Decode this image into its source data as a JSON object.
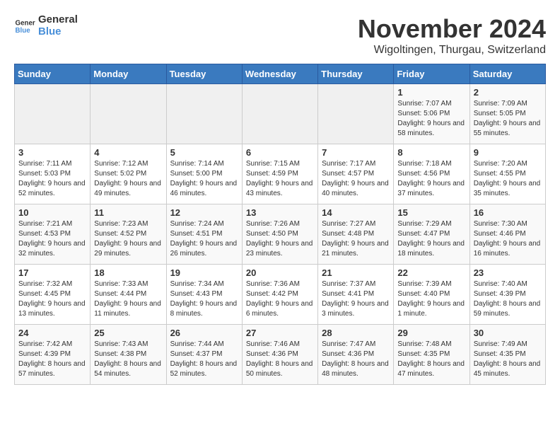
{
  "header": {
    "logo_general": "General",
    "logo_blue": "Blue",
    "month_title": "November 2024",
    "location": "Wigoltingen, Thurgau, Switzerland"
  },
  "weekdays": [
    "Sunday",
    "Monday",
    "Tuesday",
    "Wednesday",
    "Thursday",
    "Friday",
    "Saturday"
  ],
  "weeks": [
    [
      {
        "day": "",
        "info": ""
      },
      {
        "day": "",
        "info": ""
      },
      {
        "day": "",
        "info": ""
      },
      {
        "day": "",
        "info": ""
      },
      {
        "day": "",
        "info": ""
      },
      {
        "day": "1",
        "info": "Sunrise: 7:07 AM\nSunset: 5:06 PM\nDaylight: 9 hours and 58 minutes."
      },
      {
        "day": "2",
        "info": "Sunrise: 7:09 AM\nSunset: 5:05 PM\nDaylight: 9 hours and 55 minutes."
      }
    ],
    [
      {
        "day": "3",
        "info": "Sunrise: 7:11 AM\nSunset: 5:03 PM\nDaylight: 9 hours and 52 minutes."
      },
      {
        "day": "4",
        "info": "Sunrise: 7:12 AM\nSunset: 5:02 PM\nDaylight: 9 hours and 49 minutes."
      },
      {
        "day": "5",
        "info": "Sunrise: 7:14 AM\nSunset: 5:00 PM\nDaylight: 9 hours and 46 minutes."
      },
      {
        "day": "6",
        "info": "Sunrise: 7:15 AM\nSunset: 4:59 PM\nDaylight: 9 hours and 43 minutes."
      },
      {
        "day": "7",
        "info": "Sunrise: 7:17 AM\nSunset: 4:57 PM\nDaylight: 9 hours and 40 minutes."
      },
      {
        "day": "8",
        "info": "Sunrise: 7:18 AM\nSunset: 4:56 PM\nDaylight: 9 hours and 37 minutes."
      },
      {
        "day": "9",
        "info": "Sunrise: 7:20 AM\nSunset: 4:55 PM\nDaylight: 9 hours and 35 minutes."
      }
    ],
    [
      {
        "day": "10",
        "info": "Sunrise: 7:21 AM\nSunset: 4:53 PM\nDaylight: 9 hours and 32 minutes."
      },
      {
        "day": "11",
        "info": "Sunrise: 7:23 AM\nSunset: 4:52 PM\nDaylight: 9 hours and 29 minutes."
      },
      {
        "day": "12",
        "info": "Sunrise: 7:24 AM\nSunset: 4:51 PM\nDaylight: 9 hours and 26 minutes."
      },
      {
        "day": "13",
        "info": "Sunrise: 7:26 AM\nSunset: 4:50 PM\nDaylight: 9 hours and 23 minutes."
      },
      {
        "day": "14",
        "info": "Sunrise: 7:27 AM\nSunset: 4:48 PM\nDaylight: 9 hours and 21 minutes."
      },
      {
        "day": "15",
        "info": "Sunrise: 7:29 AM\nSunset: 4:47 PM\nDaylight: 9 hours and 18 minutes."
      },
      {
        "day": "16",
        "info": "Sunrise: 7:30 AM\nSunset: 4:46 PM\nDaylight: 9 hours and 16 minutes."
      }
    ],
    [
      {
        "day": "17",
        "info": "Sunrise: 7:32 AM\nSunset: 4:45 PM\nDaylight: 9 hours and 13 minutes."
      },
      {
        "day": "18",
        "info": "Sunrise: 7:33 AM\nSunset: 4:44 PM\nDaylight: 9 hours and 11 minutes."
      },
      {
        "day": "19",
        "info": "Sunrise: 7:34 AM\nSunset: 4:43 PM\nDaylight: 9 hours and 8 minutes."
      },
      {
        "day": "20",
        "info": "Sunrise: 7:36 AM\nSunset: 4:42 PM\nDaylight: 9 hours and 6 minutes."
      },
      {
        "day": "21",
        "info": "Sunrise: 7:37 AM\nSunset: 4:41 PM\nDaylight: 9 hours and 3 minutes."
      },
      {
        "day": "22",
        "info": "Sunrise: 7:39 AM\nSunset: 4:40 PM\nDaylight: 9 hours and 1 minute."
      },
      {
        "day": "23",
        "info": "Sunrise: 7:40 AM\nSunset: 4:39 PM\nDaylight: 8 hours and 59 minutes."
      }
    ],
    [
      {
        "day": "24",
        "info": "Sunrise: 7:42 AM\nSunset: 4:39 PM\nDaylight: 8 hours and 57 minutes."
      },
      {
        "day": "25",
        "info": "Sunrise: 7:43 AM\nSunset: 4:38 PM\nDaylight: 8 hours and 54 minutes."
      },
      {
        "day": "26",
        "info": "Sunrise: 7:44 AM\nSunset: 4:37 PM\nDaylight: 8 hours and 52 minutes."
      },
      {
        "day": "27",
        "info": "Sunrise: 7:46 AM\nSunset: 4:36 PM\nDaylight: 8 hours and 50 minutes."
      },
      {
        "day": "28",
        "info": "Sunrise: 7:47 AM\nSunset: 4:36 PM\nDaylight: 8 hours and 48 minutes."
      },
      {
        "day": "29",
        "info": "Sunrise: 7:48 AM\nSunset: 4:35 PM\nDaylight: 8 hours and 47 minutes."
      },
      {
        "day": "30",
        "info": "Sunrise: 7:49 AM\nSunset: 4:35 PM\nDaylight: 8 hours and 45 minutes."
      }
    ]
  ]
}
